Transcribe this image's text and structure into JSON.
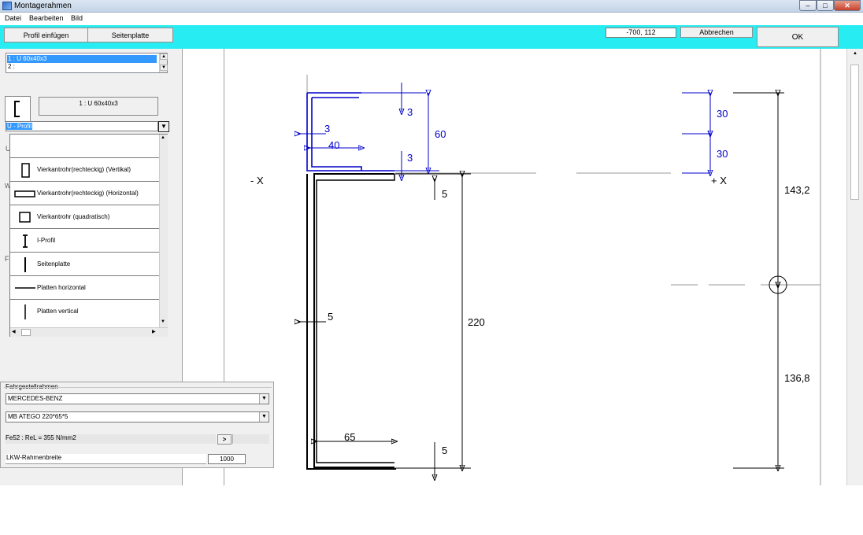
{
  "window": {
    "title": "Montagerahmen",
    "min": "–",
    "max": "□",
    "close": "✕"
  },
  "menu": [
    "Datei",
    "Bearbeiten",
    "Bild"
  ],
  "toolbar": {
    "profile_button": "Profil einfügen",
    "side_plate_button": "Seitenplatte",
    "coords": "-700, 112",
    "cancel_button": "Abbrechen",
    "ok_button": "OK"
  },
  "profile_list": [
    "1 : U 60x40x3",
    "2 :"
  ],
  "selected_profile_caption": "1 : U 60x40x3",
  "profile_type_combo": "U - Profil",
  "profile_types": [
    {
      "label": "U - Profil",
      "icon": "u-profile-icon"
    },
    {
      "label": "Vierkantrohr(rechteckig) (Vertikal)",
      "icon": "vertical-rect-tube-icon"
    },
    {
      "label": "Vierkantrohr(rechteckig) (Horizontal)",
      "icon": "horizontal-rect-tube-icon"
    },
    {
      "label": "Vierkantrohr (quadratisch)",
      "icon": "square-tube-icon"
    },
    {
      "label": "I-Profil",
      "icon": "i-profile-icon"
    },
    {
      "label": "Seitenplatte",
      "icon": "side-plate-icon"
    },
    {
      "label": "Platten horizontal",
      "icon": "plate-horizontal-icon"
    },
    {
      "label": "Platten vertical",
      "icon": "plate-vertical-icon"
    }
  ],
  "hidden_fragments": {
    "u": "U",
    "w": "W",
    "f": "F"
  },
  "chassis": {
    "group_label": "Fahrgestellrahmen",
    "manufacturer": "MERCEDES-BENZ",
    "model": "MB ATEGO   220*65*5",
    "material": "Fe52 : ReL = 355 N/mm2",
    "material_button": ">",
    "width_label": "LKW-Rahmenbreite",
    "width_value": "1000"
  },
  "drawing": {
    "axis_left": "- X",
    "axis_right": "+ X",
    "dim_top_flange": "3",
    "dim_web_thick": "3",
    "dim_top_width": "40",
    "dim_top_height": "60",
    "dim_top_bottom": "3",
    "dim_frame_top": "5",
    "dim_frame_web": "5",
    "dim_frame_height": "220",
    "dim_frame_width": "65",
    "dim_frame_bottom": "5",
    "dim_right_1": "30",
    "dim_right_2": "30",
    "dim_upper": "143,2",
    "dim_lower": "136,8"
  },
  "colors": {
    "toolbar": "#27edf2",
    "blue_dim": "#0000cc",
    "selection": "#3399ff"
  }
}
